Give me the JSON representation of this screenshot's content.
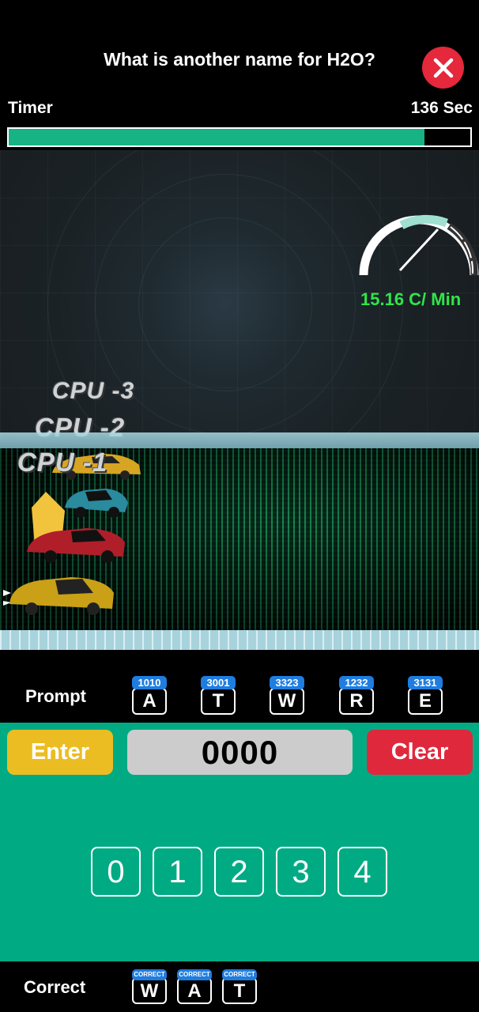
{
  "header": {
    "question": "What is another name for H2O?",
    "close_icon": "close-icon"
  },
  "timer": {
    "label": "Timer",
    "seconds_text": "136 Sec",
    "progress_fraction": 0.9
  },
  "race": {
    "speed_text": "15.16 C/ Min",
    "gauge_icon": "speedometer-icon",
    "opponents": [
      "CPU -3",
      "CPU -2",
      "CPU -1"
    ]
  },
  "prompt": {
    "label": "Prompt",
    "keys": [
      {
        "code": "1010",
        "letter": "A"
      },
      {
        "code": "3001",
        "letter": "T"
      },
      {
        "code": "3323",
        "letter": "W"
      },
      {
        "code": "1232",
        "letter": "R"
      },
      {
        "code": "3131",
        "letter": "E"
      }
    ]
  },
  "controls": {
    "enter_label": "Enter",
    "display_value": "0000",
    "clear_label": "Clear",
    "digits": [
      "0",
      "1",
      "2",
      "3",
      "4"
    ]
  },
  "correct": {
    "label": "Correct",
    "tag": "CORRECT",
    "letters": [
      "W",
      "A",
      "T"
    ]
  },
  "colors": {
    "accent_green": "#00ab84",
    "enter_yellow": "#ebbd22",
    "clear_red": "#e0283c",
    "key_blue": "#1f7de0",
    "speed_green": "#2fe64a"
  }
}
